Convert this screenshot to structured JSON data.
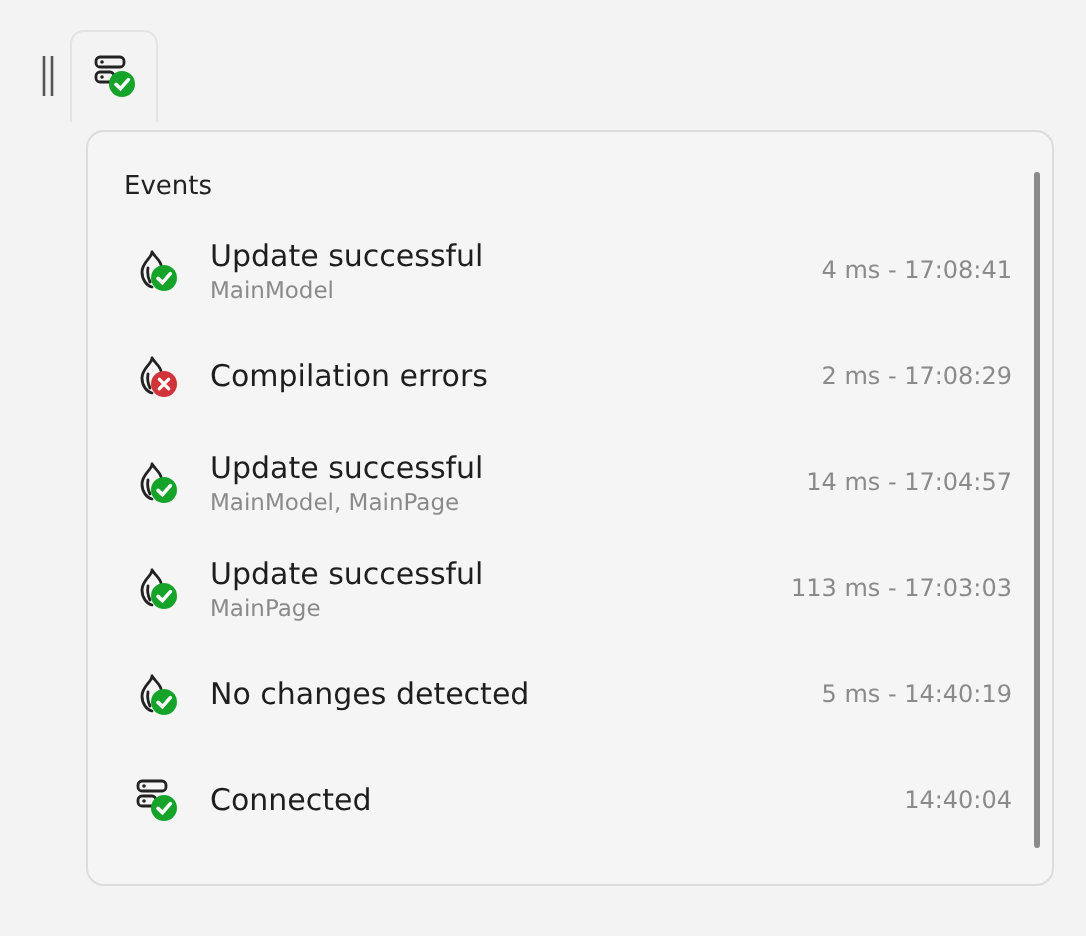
{
  "toolbar": {
    "error": false
  },
  "panel": {
    "title": "Events"
  },
  "events": [
    {
      "kind": "flame",
      "error": false,
      "title": "Update successful",
      "detail": "MainModel",
      "time": "4 ms - 17:08:41"
    },
    {
      "kind": "flame",
      "error": true,
      "title": "Compilation errors",
      "time": "2 ms - 17:08:29"
    },
    {
      "kind": "flame",
      "error": false,
      "title": "Update successful",
      "detail": "MainModel, MainPage",
      "time": "14 ms - 17:04:57"
    },
    {
      "kind": "flame",
      "error": false,
      "title": "Update successful",
      "detail": "MainPage",
      "time": "113 ms - 17:03:03"
    },
    {
      "kind": "flame",
      "error": false,
      "title": "No changes detected",
      "time": "5 ms - 14:40:19"
    },
    {
      "kind": "server",
      "error": false,
      "title": "Connected",
      "time": "14:40:04"
    }
  ]
}
